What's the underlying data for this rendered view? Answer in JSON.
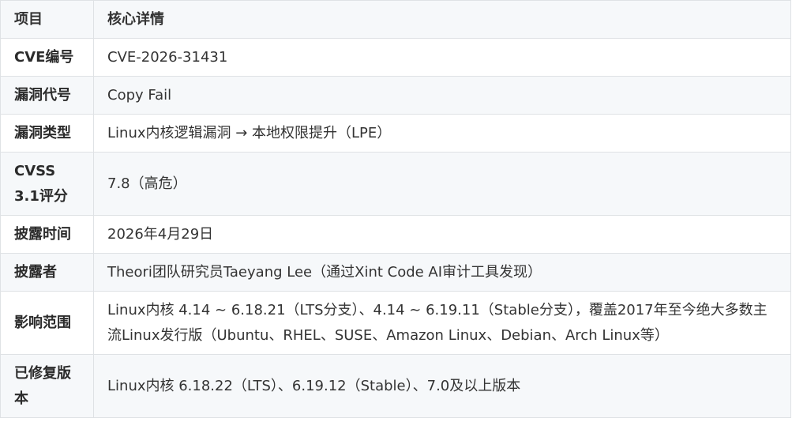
{
  "table": {
    "headers": [
      "项目",
      "核心详情"
    ],
    "rows": [
      {
        "key": "CVE编号",
        "value": "CVE-2026-31431"
      },
      {
        "key": "漏洞代号",
        "value": "Copy Fail"
      },
      {
        "key": "漏洞类型",
        "value": "Linux内核逻辑漏洞 → 本地权限提升（LPE）"
      },
      {
        "key": "CVSS 3.1评分",
        "value": "7.8（高危）"
      },
      {
        "key": "披露时间",
        "value": "2026年4月29日"
      },
      {
        "key": "披露者",
        "value": "Theori团队研究员Taeyang Lee（通过Xint Code AI审计工具发现）"
      },
      {
        "key": "影响范围",
        "value": "Linux内核 4.14 ~ 6.18.21（LTS分支）、4.14 ~ 6.19.11（Stable分支），覆盖2017年至今绝大多数主流Linux发行版（Ubuntu、RHEL、SUSE、Amazon Linux、Debian、Arch Linux等）"
      },
      {
        "key": "已修复版本",
        "value": "Linux内核 6.18.22（LTS）、6.19.12（Stable）、7.0及以上版本"
      }
    ]
  }
}
